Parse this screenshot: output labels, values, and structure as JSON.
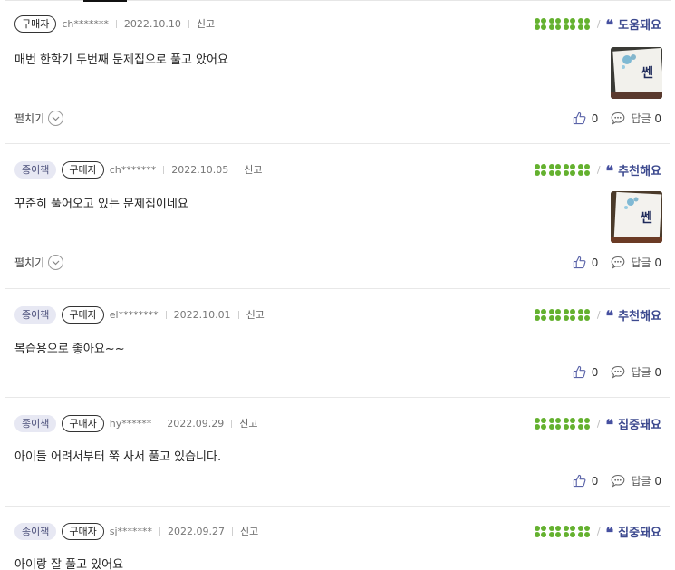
{
  "reviews": [
    {
      "badges": [
        "구매자"
      ],
      "user": "ch*******",
      "date": "2022.10.10",
      "report": "신고",
      "rating_clovers": 4,
      "tag": "도움돼요",
      "body": "매번 한학기 두번째 문제집으로 풀고 았어요",
      "has_photo": true,
      "photo_text": "쎈",
      "fold_label": "펼치기",
      "like_count": "0",
      "reply_label": "답글",
      "reply_count": "0"
    },
    {
      "badges": [
        "종이책",
        "구매자"
      ],
      "user": "ch*******",
      "date": "2022.10.05",
      "report": "신고",
      "rating_clovers": 4,
      "tag": "추천해요",
      "body": "꾸준히 풀어오고 있는 문제집이네요",
      "has_photo": true,
      "photo_text": "쎈",
      "fold_label": "펼치기",
      "like_count": "0",
      "reply_label": "답글",
      "reply_count": "0"
    },
    {
      "badges": [
        "종이책",
        "구매자"
      ],
      "user": "el********",
      "date": "2022.10.01",
      "report": "신고",
      "rating_clovers": 4,
      "tag": "추천해요",
      "body": "복습용으로 좋아요~~",
      "has_photo": false,
      "like_count": "0",
      "reply_label": "답글",
      "reply_count": "0"
    },
    {
      "badges": [
        "종이책",
        "구매자"
      ],
      "user": "hy******",
      "date": "2022.09.29",
      "report": "신고",
      "rating_clovers": 4,
      "tag": "집중돼요",
      "body": "아이들 어려서부터 쭉 사서 풀고 있습니다.",
      "has_photo": false,
      "like_count": "0",
      "reply_label": "답글",
      "reply_count": "0"
    },
    {
      "badges": [
        "종이책",
        "구매자"
      ],
      "user": "sj*******",
      "date": "2022.09.27",
      "report": "신고",
      "rating_clovers": 4,
      "tag": "집중돼요",
      "body": "아이랑 잘 풀고 있어요",
      "has_photo": false
    }
  ],
  "colors": {
    "clover": "#64b12f",
    "tag": "#3d4a8f",
    "badge_bg": "#e7e8f3"
  },
  "icons": {
    "rating": "clover-icon",
    "tag": "quote-icon",
    "like": "thumbs-up-icon",
    "reply": "speech-bubble-icon",
    "fold": "chevron-down-icon"
  }
}
